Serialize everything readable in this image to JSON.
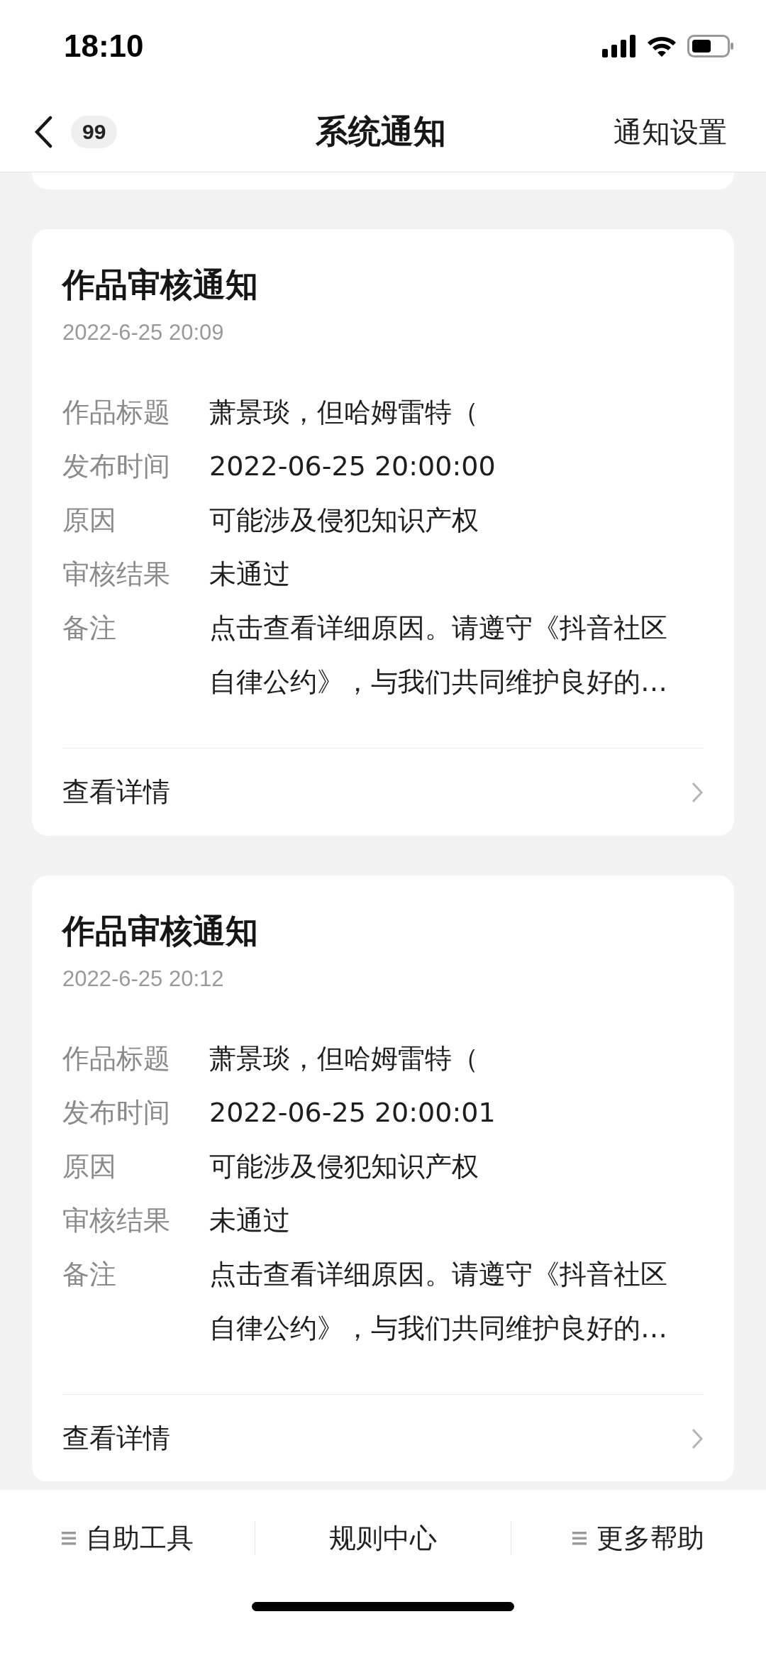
{
  "status_bar": {
    "time": "18:10"
  },
  "nav": {
    "back_badge": "99",
    "title": "系统通知",
    "action": "通知设置"
  },
  "notices": [
    {
      "title": "作品审核通知",
      "date": "2022-6-25 20:09",
      "fields": [
        {
          "label": "作品标题",
          "value": "萧景琰，但哈姆雷特（"
        },
        {
          "label": "发布时间",
          "value": "2022-06-25 20:00:00"
        },
        {
          "label": "原因",
          "value": "可能涉及侵犯知识产权"
        },
        {
          "label": "审核结果",
          "value": "未通过"
        },
        {
          "label": "备注",
          "value": "点击查看详细原因。请遵守《抖音社区自律公约》，与我们共同维护良好的…"
        }
      ],
      "link": "查看详情"
    },
    {
      "title": "作品审核通知",
      "date": "2022-6-25 20:12",
      "fields": [
        {
          "label": "作品标题",
          "value": "萧景琰，但哈姆雷特（"
        },
        {
          "label": "发布时间",
          "value": "2022-06-25 20:00:01"
        },
        {
          "label": "原因",
          "value": "可能涉及侵犯知识产权"
        },
        {
          "label": "审核结果",
          "value": "未通过"
        },
        {
          "label": "备注",
          "value": "点击查看详细原因。请遵守《抖音社区自律公约》，与我们共同维护良好的…"
        }
      ],
      "link": "查看详情"
    }
  ],
  "bottom_bar": [
    {
      "label": "自助工具",
      "has_menu": true
    },
    {
      "label": "规则中心",
      "has_menu": false
    },
    {
      "label": "更多帮助",
      "has_menu": true
    }
  ]
}
